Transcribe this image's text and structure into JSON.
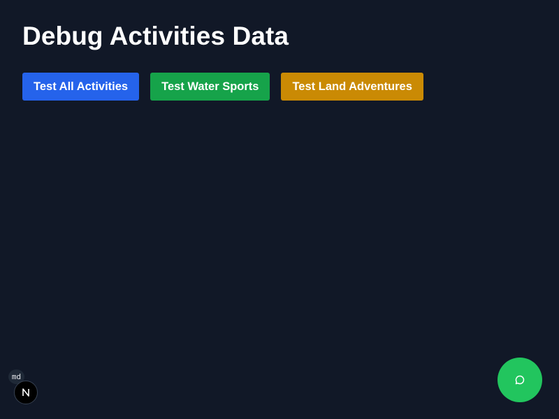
{
  "page": {
    "title": "Debug Activities Data"
  },
  "buttons": {
    "all": "Test All Activities",
    "water": "Test Water Sports",
    "land": "Test Land Adventures"
  },
  "dev": {
    "md_label": "md",
    "next_icon": "nextjs-logo-icon"
  },
  "chat": {
    "icon": "chat-bubble-icon"
  },
  "colors": {
    "background": "#111827",
    "blue": "#2563eb",
    "green": "#16a34a",
    "amber": "#ca8a04",
    "chat": "#22c55e"
  }
}
